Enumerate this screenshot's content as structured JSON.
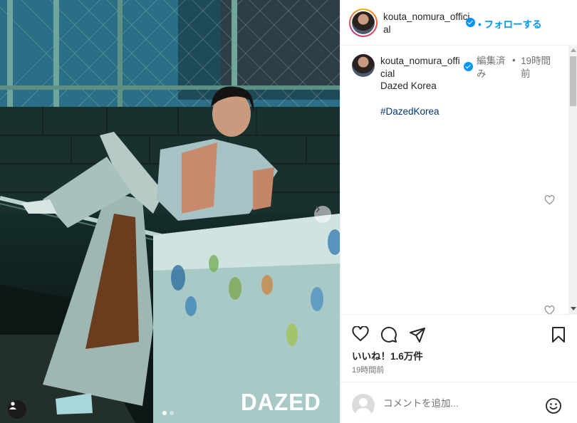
{
  "post": {
    "image": {
      "watermark": "DAZED",
      "dots_total": 2,
      "dots_active": 1,
      "next_icon": "chevron-right-icon",
      "tag_icon": "user-tag-icon"
    }
  },
  "header": {
    "username": "kouta_nomura_official",
    "verified_icon": "verified-badge-icon",
    "separator": "•",
    "follow_label": "フォローする"
  },
  "caption": {
    "username": "kouta_nomura_official",
    "edited_label": "編集済み",
    "separator": "•",
    "time": "19時間前",
    "text": "Dazed Korea",
    "hashtag": "#DazedKorea"
  },
  "actions": {
    "like_icon": "heart-icon",
    "comment_icon": "comment-bubble-icon",
    "share_icon": "paper-plane-icon",
    "save_icon": "bookmark-icon",
    "likes_text": "いいね！1.6万件",
    "posted_time": "19時間前"
  },
  "comment_bar": {
    "placeholder": "コメントを追加...",
    "emoji_icon": "smiley-face-icon"
  },
  "colors": {
    "accent_blue": "#0095f6",
    "hashtag_blue": "#00376b",
    "muted": "#737373"
  }
}
